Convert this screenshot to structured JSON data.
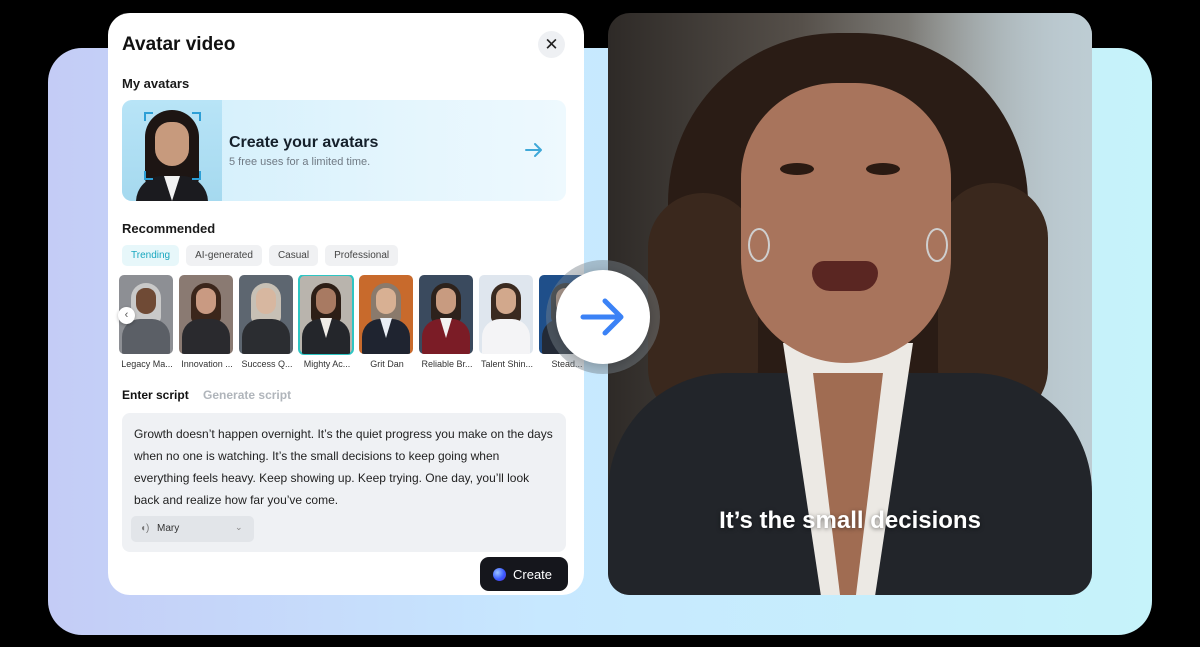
{
  "panel": {
    "title": "Avatar video",
    "close_icon": "close-icon",
    "my_avatars_label": "My avatars",
    "create_card": {
      "title": "Create your avatars",
      "subtitle": "5 free uses for a limited time.",
      "arrow_icon": "arrow-right-icon"
    },
    "recommended_label": "Recommended",
    "tabs": [
      {
        "label": "Trending",
        "active": true
      },
      {
        "label": "AI-generated",
        "active": false
      },
      {
        "label": "Casual",
        "active": false
      },
      {
        "label": "Professional",
        "active": false
      }
    ],
    "avatars": [
      {
        "label": "Legacy Ma..."
      },
      {
        "label": "Innovation ..."
      },
      {
        "label": "Success Q..."
      },
      {
        "label": "Mighty Ac...",
        "selected": true
      },
      {
        "label": "Grit Dan"
      },
      {
        "label": "Reliable Br..."
      },
      {
        "label": "Talent Shin..."
      },
      {
        "label": "Stead..."
      }
    ],
    "script_tabs": {
      "enter": "Enter script",
      "generate": "Generate script"
    },
    "script_text": "Growth doesn’t happen overnight. It’s the quiet progress you make on the days when no one is watching. It’s the small decisions to keep going when everything feels heavy. Keep showing up. Keep trying. One day, you’ll look back and realize how far you’ve come.",
    "voice": {
      "name": "Mary",
      "icon": "voice-wave-icon"
    },
    "create_button": "Create"
  },
  "video": {
    "caption": "It’s the small decisions"
  },
  "colors": {
    "accent_teal": "#19a7bf",
    "arrow_blue": "#3b82f6",
    "button_dark": "#15161c"
  }
}
